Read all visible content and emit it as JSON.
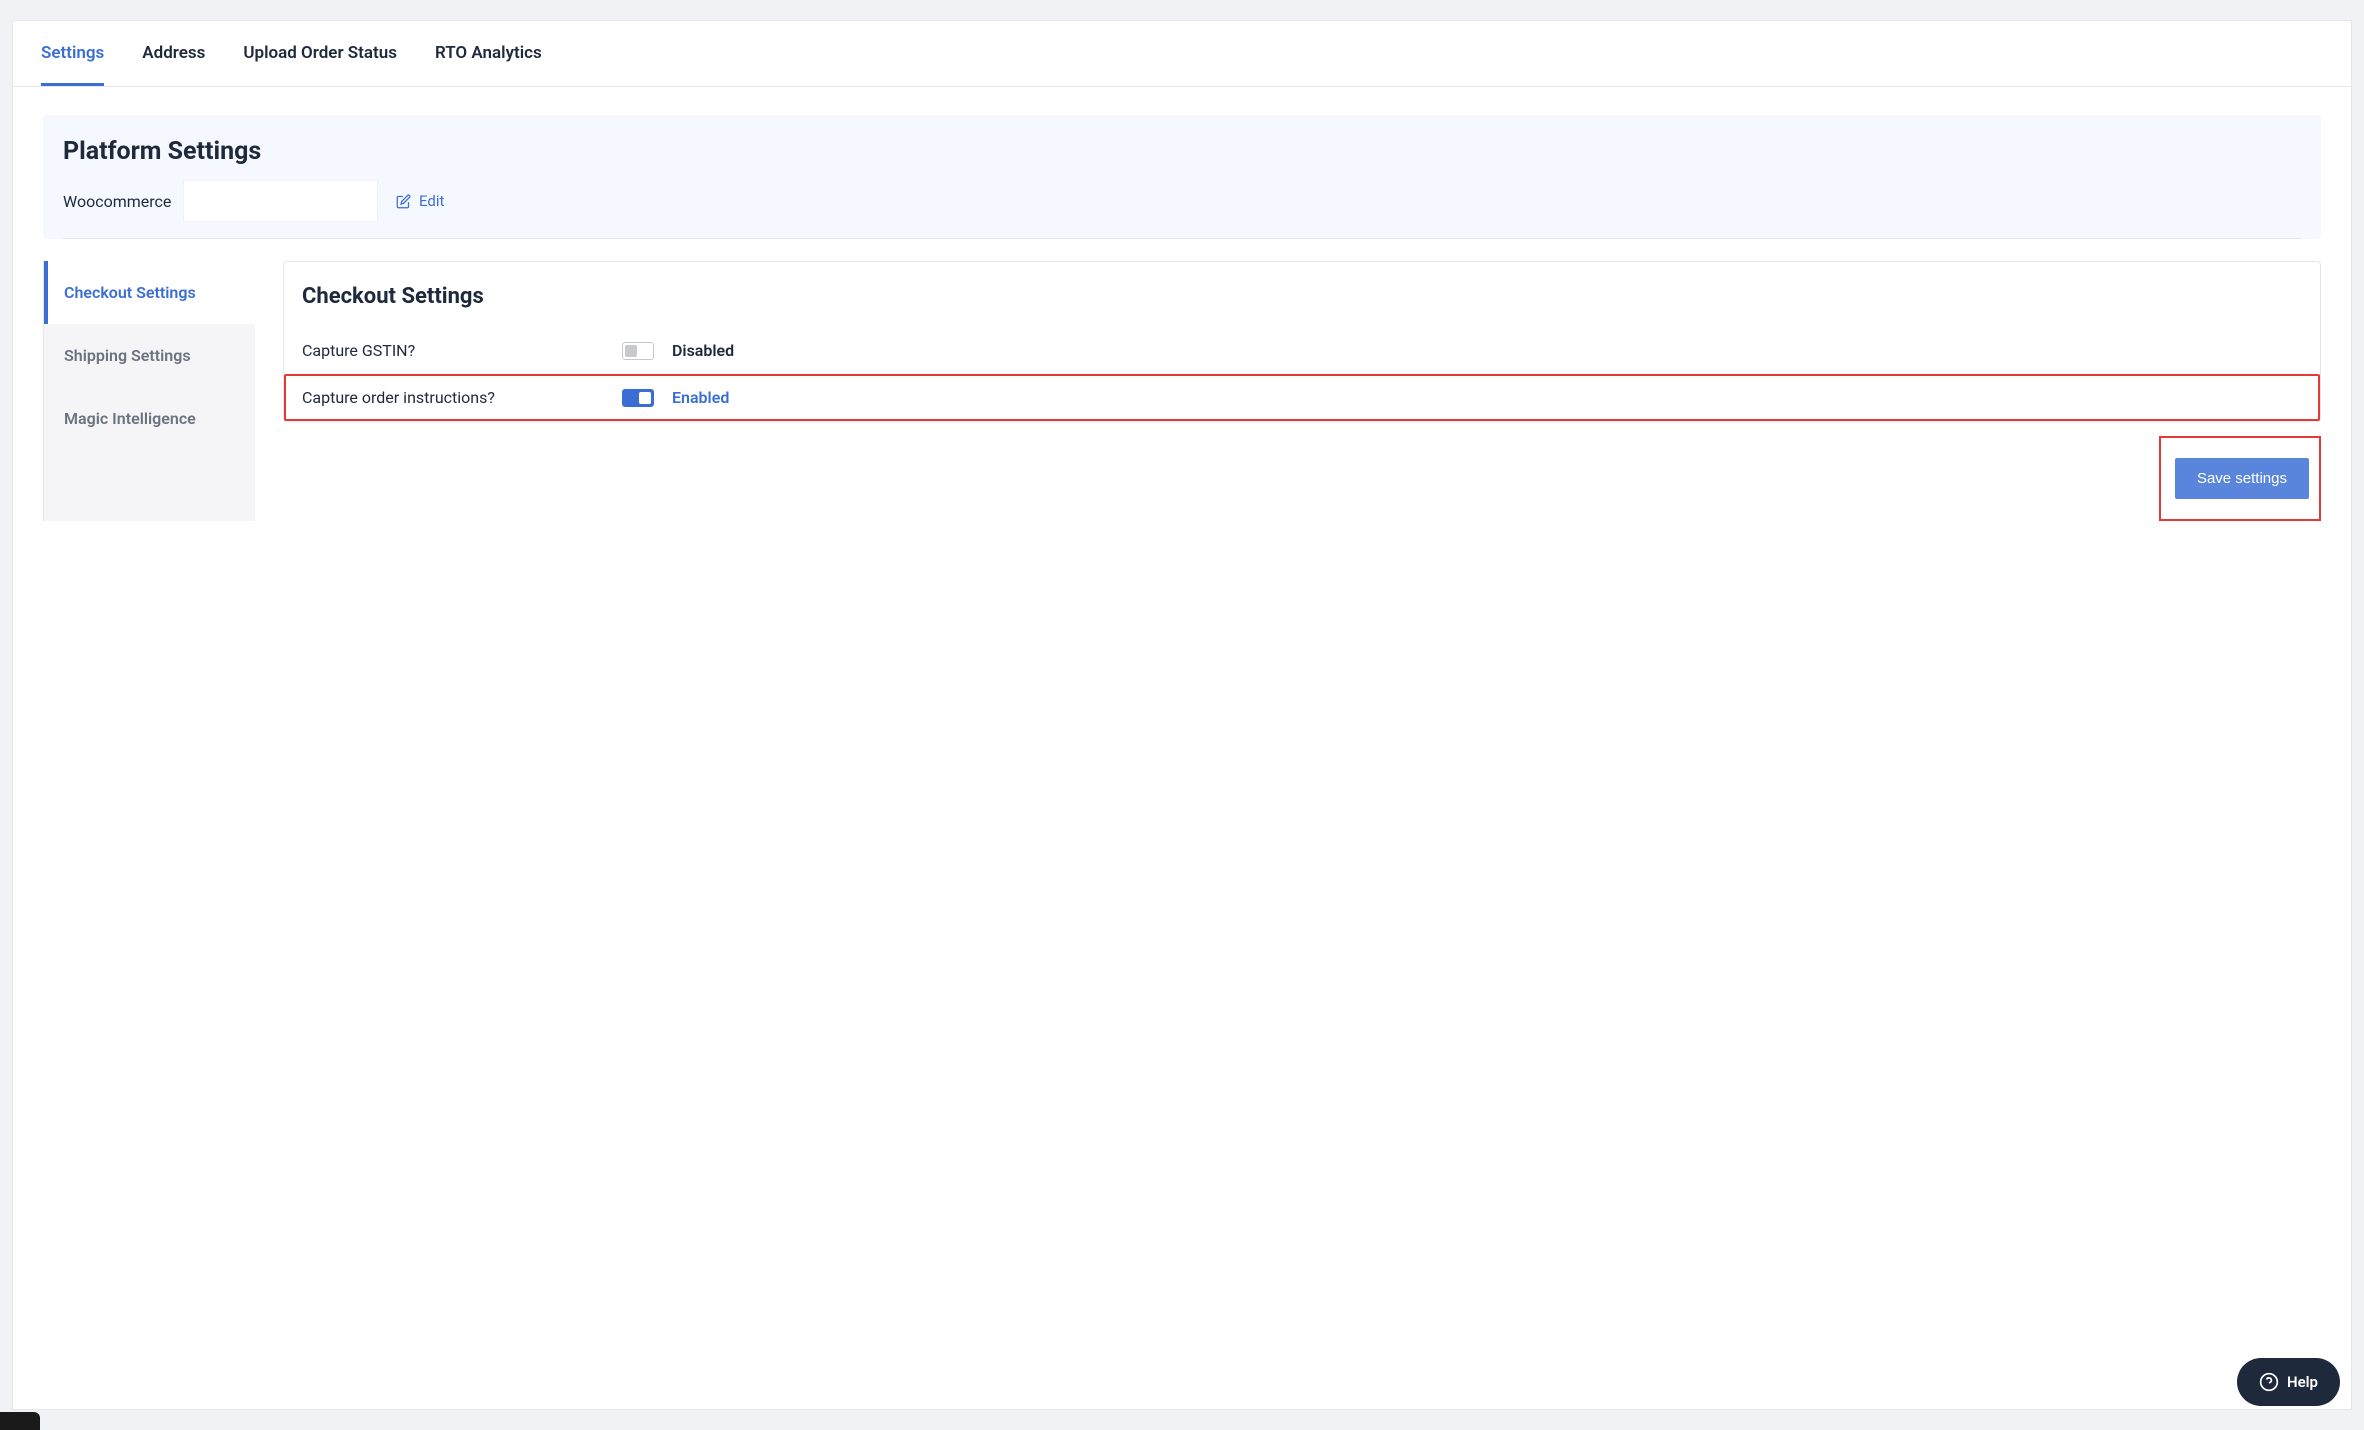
{
  "topTabs": [
    {
      "label": "Settings",
      "active": true
    },
    {
      "label": "Address",
      "active": false
    },
    {
      "label": "Upload Order Status",
      "active": false
    },
    {
      "label": "RTO Analytics",
      "active": false
    }
  ],
  "platform": {
    "title": "Platform Settings",
    "name": "Woocommerce",
    "editLabel": "Edit"
  },
  "sideTabs": [
    {
      "label": "Checkout Settings",
      "active": true
    },
    {
      "label": "Shipping Settings",
      "active": false
    },
    {
      "label": "Magic Intelligence",
      "active": false
    }
  ],
  "checkout": {
    "title": "Checkout Settings",
    "rows": [
      {
        "label": "Capture GSTIN?",
        "enabled": false,
        "status": "Disabled",
        "highlighted": false
      },
      {
        "label": "Capture order instructions?",
        "enabled": true,
        "status": "Enabled",
        "highlighted": true
      }
    ]
  },
  "saveButton": "Save settings",
  "help": "Help"
}
